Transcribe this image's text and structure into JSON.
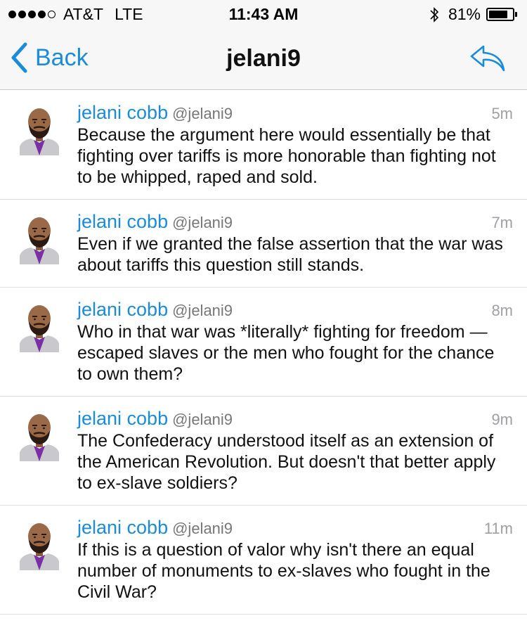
{
  "status_bar": {
    "carrier": "AT&T",
    "network": "LTE",
    "time": "11:43 AM",
    "battery": "81%",
    "battery_level": 0.81
  },
  "nav": {
    "back_label": "Back",
    "title": "jelani9"
  },
  "tweets": [
    {
      "name": "jelani cobb",
      "handle": "@jelani9",
      "time": "5m",
      "text": "Because the argument here would essentially be that fighting over tariffs is more honorable than fighting not to be whipped, raped and sold."
    },
    {
      "name": "jelani cobb",
      "handle": "@jelani9",
      "time": "7m",
      "text": "Even if we granted the false assertion that the war was about tariffs this question still stands."
    },
    {
      "name": "jelani cobb",
      "handle": "@jelani9",
      "time": "8m",
      "text": "Who in that war was *literally* fighting for freedom — escaped slaves or the men who fought for the chance to own them?"
    },
    {
      "name": "jelani cobb",
      "handle": "@jelani9",
      "time": "9m",
      "text": "The Confederacy understood itself as an extension of the American Revolution. But doesn't that better apply to ex-slave soldiers?"
    },
    {
      "name": "jelani cobb",
      "handle": "@jelani9",
      "time": "11m",
      "text": "If this is a question of valor why isn't there an equal number of monuments to ex-slaves who fought in the Civil War?"
    }
  ],
  "colors": {
    "accent": "#1a8cde",
    "name": "#1a8cde",
    "handle": "#777777",
    "time": "#a0a0a5",
    "divider": "#e1e1e4"
  },
  "icons": {
    "back": "chevron-left-icon",
    "reply": "reply-arrow-icon",
    "bluetooth": "bluetooth-icon",
    "battery": "battery-icon",
    "avatar": "avatar-illustration"
  }
}
